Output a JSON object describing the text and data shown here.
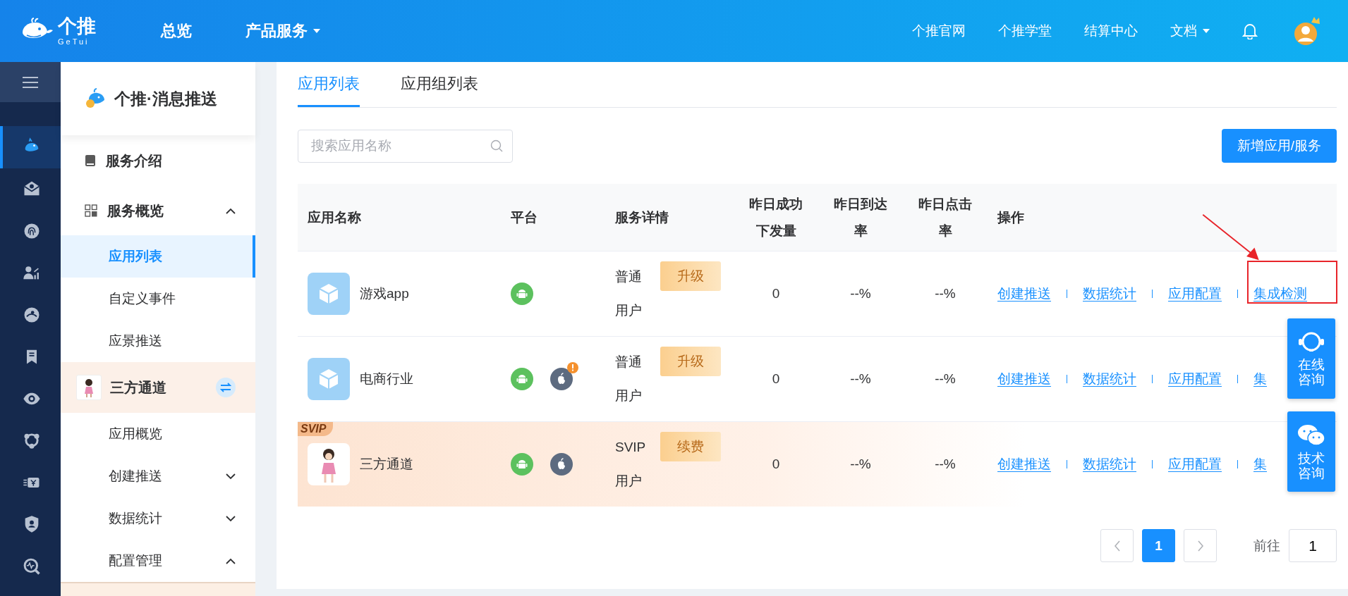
{
  "top_nav": {
    "logo_text": "个推",
    "logo_subtext": "GeTui",
    "left_items": [
      {
        "label": "总览",
        "dropdown": false
      },
      {
        "label": "产品服务",
        "dropdown": true
      }
    ],
    "right_items": [
      {
        "label": "个推官网",
        "dropdown": false
      },
      {
        "label": "个推学堂",
        "dropdown": false
      },
      {
        "label": "结算中心",
        "dropdown": false
      },
      {
        "label": "文档",
        "dropdown": true
      }
    ]
  },
  "icon_rail": {
    "items": [
      {
        "kind": "whale",
        "selected": true
      },
      {
        "kind": "mail",
        "selected": false
      },
      {
        "kind": "fingerprint",
        "selected": false
      },
      {
        "kind": "users",
        "selected": false
      },
      {
        "kind": "face",
        "selected": false
      },
      {
        "kind": "bookmarks",
        "selected": false
      },
      {
        "kind": "eye",
        "selected": false
      },
      {
        "kind": "share",
        "selected": false
      },
      {
        "kind": "money",
        "selected": false
      },
      {
        "kind": "shield",
        "selected": false
      },
      {
        "kind": "monitor",
        "selected": false
      }
    ]
  },
  "sidebar": {
    "title": "个推·消息推送",
    "items": [
      {
        "kind": "section",
        "label": "服务介绍",
        "selected": false
      },
      {
        "kind": "group",
        "label": "服务概览",
        "selected": false,
        "expanded": true
      },
      {
        "kind": "item",
        "label": "应用列表",
        "selected": true
      },
      {
        "kind": "item",
        "label": "自定义事件",
        "selected": false
      },
      {
        "kind": "item",
        "label": "应景推送",
        "selected": false
      },
      {
        "kind": "svip",
        "label": "三方通道",
        "selected": false
      },
      {
        "kind": "item",
        "label": "应用概览",
        "selected": false
      },
      {
        "kind": "subgroup",
        "label": "创建推送",
        "selected": false,
        "expanded": false
      },
      {
        "kind": "subgroup",
        "label": "数据统计",
        "selected": false,
        "expanded": false
      },
      {
        "kind": "subgroup",
        "label": "配置管理",
        "selected": false,
        "expanded": true
      }
    ]
  },
  "tabs": [
    {
      "label": "应用列表",
      "selected": true
    },
    {
      "label": "应用组列表",
      "selected": false
    }
  ],
  "search": {
    "placeholder": "搜索应用名称"
  },
  "add_button": "新增应用/服务",
  "table": {
    "columns": [
      "应用名称",
      "平台",
      "服务详情",
      "昨日成功下发量",
      "昨日到达率",
      "昨日点击率",
      "操作"
    ],
    "rows": [
      {
        "kind": "app",
        "name": "游戏app",
        "platforms": [
          {
            "kind": "android",
            "alert": false
          }
        ],
        "plan": "普通用户",
        "plan_action": "升级",
        "sent": "0",
        "arrival_rate": "--%",
        "click_rate": "--%",
        "actions": [
          "创建推送",
          "数据统计",
          "应用配置",
          "集成检测"
        ]
      },
      {
        "kind": "app",
        "name": "电商行业",
        "platforms": [
          {
            "kind": "android",
            "alert": false
          },
          {
            "kind": "apple",
            "alert": true
          }
        ],
        "plan": "普通用户",
        "plan_action": "升级",
        "sent": "0",
        "arrival_rate": "--%",
        "click_rate": "--%",
        "actions": [
          "创建推送",
          "数据统计",
          "应用配置",
          "集"
        ]
      },
      {
        "kind": "svip",
        "badge": "SVIP",
        "name": "三方通道",
        "platforms": [
          {
            "kind": "android",
            "alert": false
          },
          {
            "kind": "apple",
            "alert": false
          }
        ],
        "plan": "SVIP用户",
        "plan_action": "续费",
        "sent": "0",
        "arrival_rate": "--%",
        "click_rate": "--%",
        "actions": [
          "创建推送",
          "数据统计",
          "应用配置",
          "集"
        ]
      }
    ]
  },
  "pagination": {
    "pages": [
      {
        "label": "1",
        "selected": true
      }
    ],
    "goto_label": "前往",
    "goto_value": "1"
  },
  "float_buttons": [
    {
      "kind": "headset",
      "label": "在线咨询"
    },
    {
      "kind": "chat",
      "label": "技术咨询"
    }
  ]
}
